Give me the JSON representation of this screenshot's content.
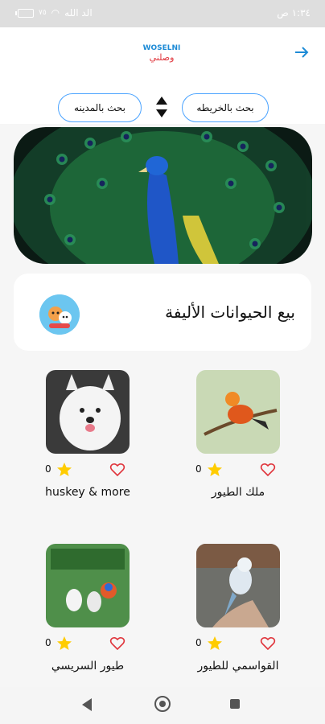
{
  "status": {
    "time": "١:٣٤ ص",
    "battery": "٧٥",
    "network": "الد الله"
  },
  "header": {
    "logo_text_latin": "WOSELNI",
    "logo_text_arabic": "وصلني",
    "back_icon": "arrow-right-icon"
  },
  "filters": {
    "map_search": "بحث بالخريطه",
    "city_search": "بحث بالمدينه",
    "sort_icon": "sort-icon"
  },
  "category": {
    "title": "بيع الحيوانات الأليفة"
  },
  "listings": [
    {
      "name": "ملك الطيور",
      "likes": "0"
    },
    {
      "name": "huskey & more",
      "likes": "0"
    },
    {
      "name": "القواسمي للطيور",
      "likes": "0"
    },
    {
      "name": "طيور السريسي",
      "likes": "0"
    }
  ],
  "colors": {
    "accent": "#1d8bd6",
    "pill_border": "#4aa3ff",
    "heart": "#e0343b",
    "star": "#ffcc00"
  }
}
